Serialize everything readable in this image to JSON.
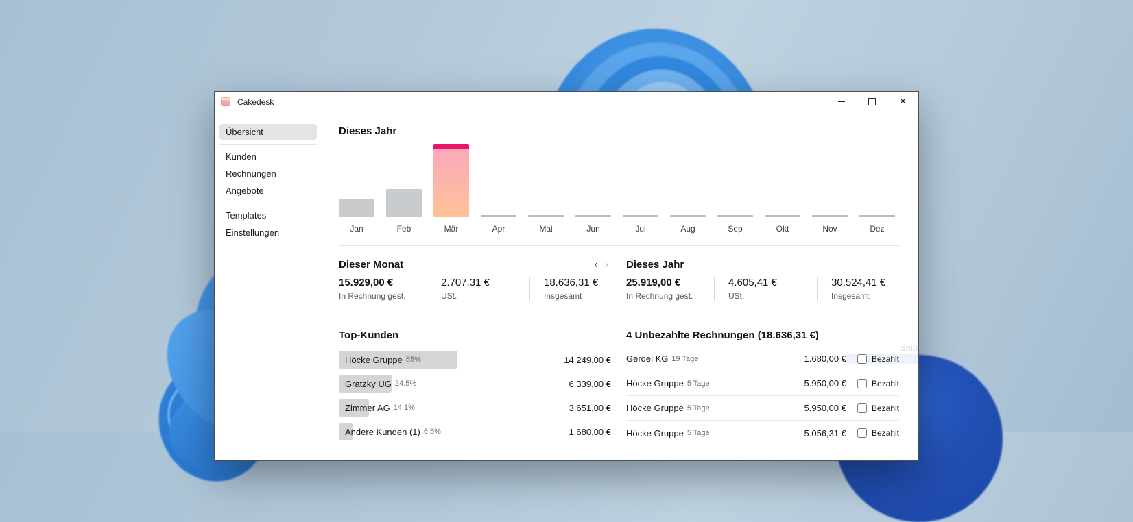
{
  "window": {
    "title": "Cakedesk",
    "controls": {
      "minimize": "minimize",
      "maximize": "maximize",
      "close": "×"
    }
  },
  "sidebar": {
    "items": [
      {
        "label": "Übersicht",
        "selected": true
      },
      {
        "label": "Kunden",
        "selected": false
      },
      {
        "label": "Rechnungen",
        "selected": false
      },
      {
        "label": "Angebote",
        "selected": false
      },
      {
        "label": "Templates",
        "selected": false
      },
      {
        "label": "Einstellungen",
        "selected": false
      }
    ]
  },
  "chart_data": {
    "type": "bar",
    "title": "Dieses Jahr",
    "categories": [
      "Jan",
      "Feb",
      "Mär",
      "Apr",
      "Mai",
      "Jun",
      "Jul",
      "Aug",
      "Sep",
      "Okt",
      "Nov",
      "Dez"
    ],
    "values": [
      3900,
      6100,
      15929,
      0,
      0,
      0,
      0,
      0,
      0,
      0,
      0,
      0
    ],
    "max_value": 15929,
    "unit": "EUR",
    "highlight_index": 2,
    "highlight_color": "#ea1566",
    "bar_color": "#c9ccce",
    "xlabel": "",
    "ylabel": "",
    "grid": false,
    "legend": false
  },
  "stats": {
    "nav": {
      "prev": "‹",
      "next": "›"
    },
    "month": {
      "title": "Dieser Monat",
      "cells": [
        {
          "value": "15.929,00 €",
          "label": "In Rechnung gest."
        },
        {
          "value": "2.707,31 €",
          "label": "USt."
        },
        {
          "value": "18.636,31 €",
          "label": "Insgesamt"
        }
      ]
    },
    "year": {
      "title": "Dieses Jahr",
      "cells": [
        {
          "value": "25.919,00 €",
          "label": "In Rechnung gest."
        },
        {
          "value": "4.605,41 €",
          "label": "USt."
        },
        {
          "value": "30.524,41 €",
          "label": "Insgesamt"
        }
      ]
    }
  },
  "top_customers": {
    "title": "Top-Kunden",
    "rows": [
      {
        "name": "Höcke Gruppe",
        "pct": "55%",
        "pct_value": 55,
        "amount": "14.249,00 €"
      },
      {
        "name": "Gratzky UG",
        "pct": "24.5%",
        "pct_value": 24.5,
        "amount": "6.339,00 €"
      },
      {
        "name": "Zimmer AG",
        "pct": "14.1%",
        "pct_value": 14.1,
        "amount": "3.651,00 €"
      },
      {
        "name": "Andere Kunden (1)",
        "pct": "6.5%",
        "pct_value": 6.5,
        "amount": "1.680,00 €"
      }
    ]
  },
  "unpaid": {
    "title": "4 Unbezahlte Rechnungen (18.636,31 €)",
    "checkbox_label": "Bezahlt",
    "rows": [
      {
        "name": "Gerdel KG",
        "age": "19 Tage",
        "amount": "1.680,00 €"
      },
      {
        "name": "Höcke Gruppe",
        "age": "5 Tage",
        "amount": "5.950,00 €"
      },
      {
        "name": "Höcke Gruppe",
        "age": "5 Tage",
        "amount": "5.950,00 €"
      },
      {
        "name": "Höcke Gruppe",
        "age": "5 Tage",
        "amount": "5.056,31 €"
      }
    ]
  },
  "artifact": {
    "snip_text": "Snip"
  },
  "colors": {
    "accent_pink": "#ea1566",
    "bar_gray": "#c9ccce",
    "highlight_top": "#fba9ba",
    "highlight_bottom": "#fdc298",
    "selected_item_bg": "#e4e4e4"
  }
}
